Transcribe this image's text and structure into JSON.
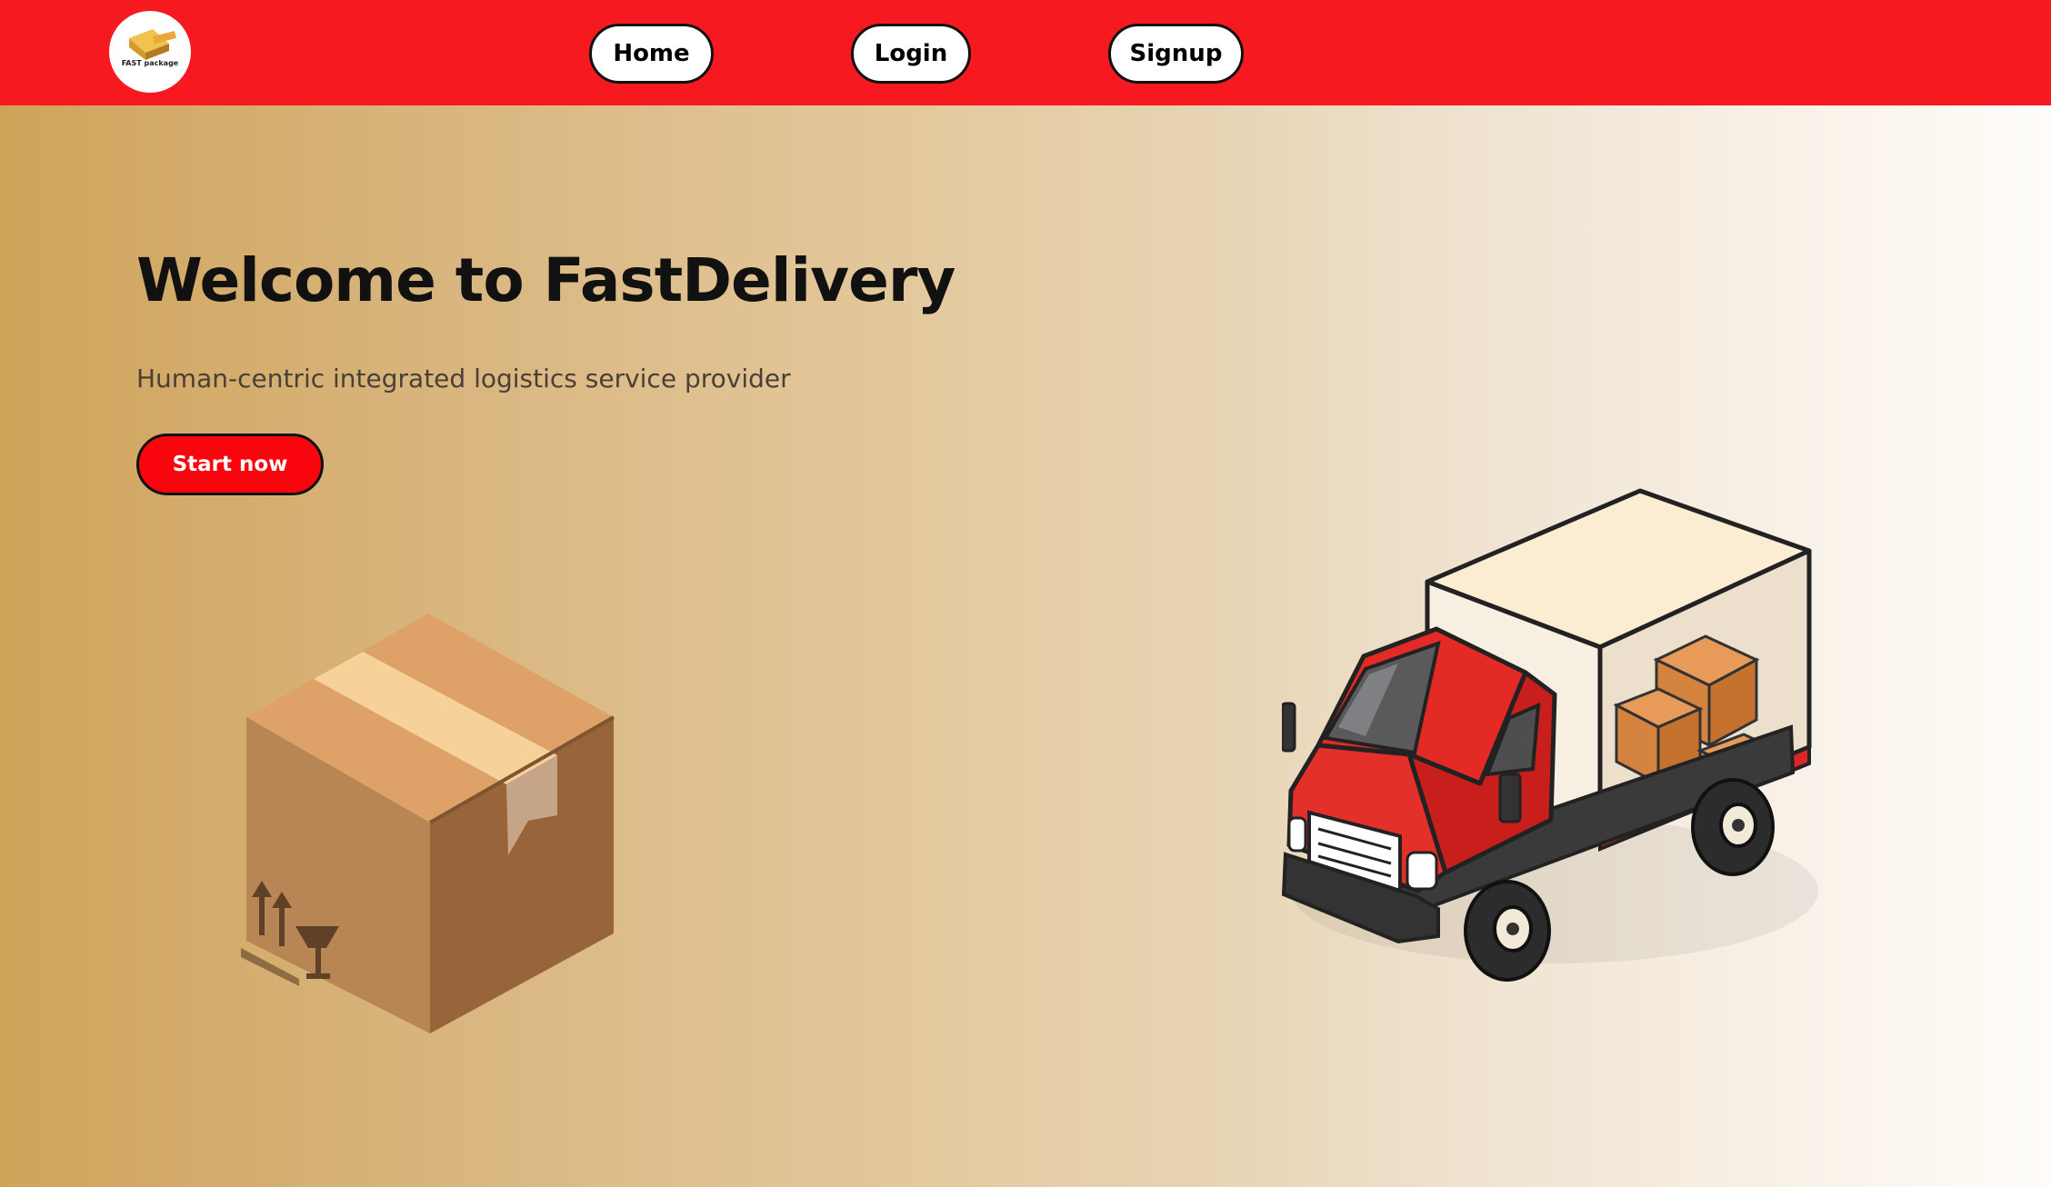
{
  "nav": {
    "logo_text": "FAST package",
    "home_label": "Home",
    "login_label": "Login",
    "signup_label": "Signup"
  },
  "hero": {
    "title": "Welcome to FastDelivery",
    "subtitle": "Human-centric integrated logistics service provider",
    "cta_label": "Start now"
  },
  "colors": {
    "nav_bg": "#f71920",
    "cta_bg": "#f8050d",
    "hero_gradient_start": "#cfa35a",
    "hero_gradient_end": "#fffdf9"
  },
  "icons": [
    "logo-icon",
    "box-illustration",
    "truck-illustration"
  ]
}
